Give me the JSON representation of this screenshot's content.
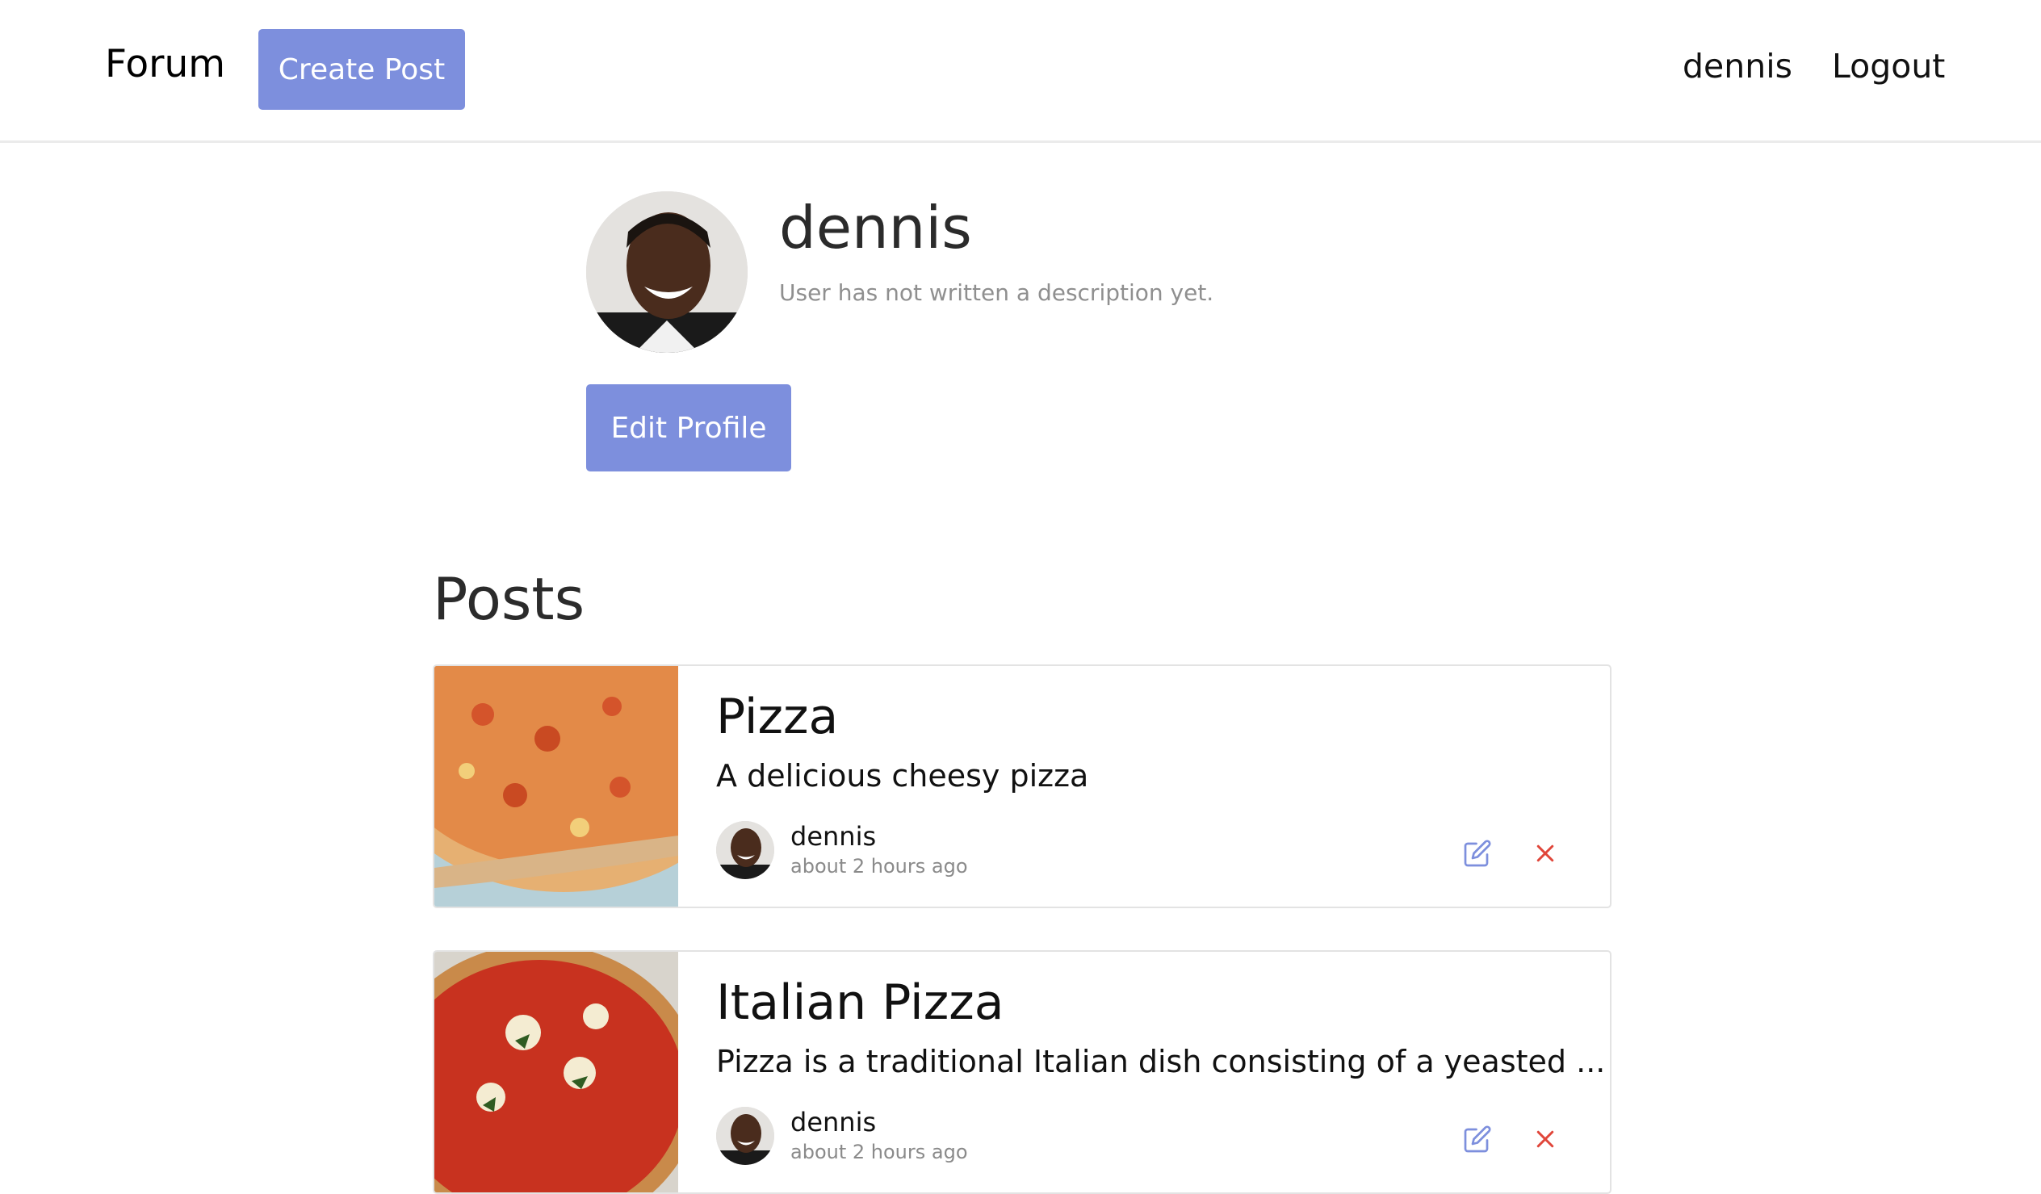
{
  "navbar": {
    "brand": "Forum",
    "create_post": "Create Post",
    "username": "dennis",
    "logout": "Logout"
  },
  "profile": {
    "name": "dennis",
    "description": "User has not written a description yet.",
    "edit_button": "Edit Profile"
  },
  "posts_heading": "Posts",
  "posts": [
    {
      "title": "Pizza",
      "excerpt": "A delicious cheesy pizza",
      "author": "dennis",
      "time": "about 2 hours ago"
    },
    {
      "title": "Italian Pizza",
      "excerpt": "Pizza is a traditional Italian dish consisting of a yeasted ...",
      "author": "dennis",
      "time": "about 2 hours ago"
    }
  ],
  "icons": {
    "edit": "edit-icon",
    "delete": "close-icon"
  },
  "colors": {
    "accent": "#7d8fdd",
    "delete": "#e0463a"
  }
}
